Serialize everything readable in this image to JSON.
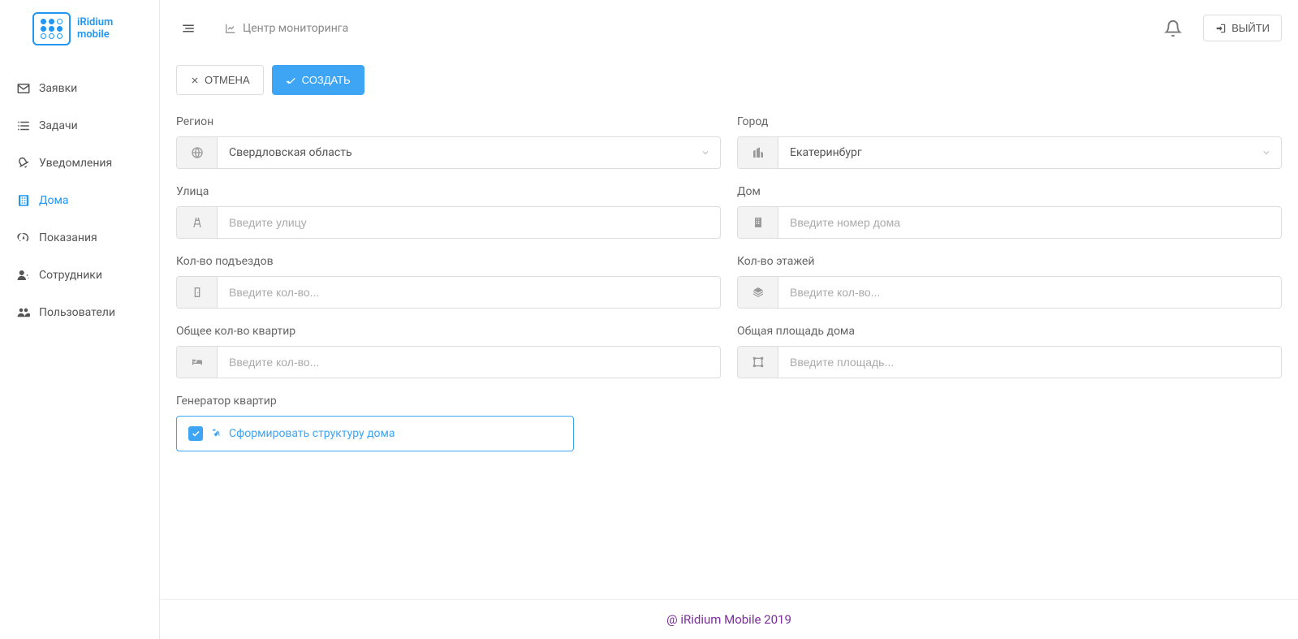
{
  "logo": {
    "line1": "iRidium",
    "line2": "mobile"
  },
  "sidebar": {
    "items": [
      {
        "label": "Заявки",
        "icon": "envelope"
      },
      {
        "label": "Задачи",
        "icon": "list-check"
      },
      {
        "label": "Уведомления",
        "icon": "bullhorn"
      },
      {
        "label": "Дома",
        "icon": "building",
        "active": true
      },
      {
        "label": "Показания",
        "icon": "gauge"
      },
      {
        "label": "Сотрудники",
        "icon": "user-gear"
      },
      {
        "label": "Пользователи",
        "icon": "users"
      }
    ]
  },
  "topbar": {
    "breadcrumb": "Центр мониторинга",
    "logout": "ВЫЙТИ"
  },
  "actions": {
    "cancel": "ОТМЕНА",
    "create": "СОЗДАТЬ"
  },
  "form": {
    "region": {
      "label": "Регион",
      "value": "Свердловская область"
    },
    "city": {
      "label": "Город",
      "value": "Екатеринбург"
    },
    "street": {
      "label": "Улица",
      "placeholder": "Введите улицу"
    },
    "house": {
      "label": "Дом",
      "placeholder": "Введите номер дома"
    },
    "entrances": {
      "label": "Кол-во подъездов",
      "placeholder": "Введите кол-во..."
    },
    "floors": {
      "label": "Кол-во этажей",
      "placeholder": "Введите кол-во..."
    },
    "apartments": {
      "label": "Общее кол-во квартир",
      "placeholder": "Введите кол-во..."
    },
    "area": {
      "label": "Общая площадь дома",
      "placeholder": "Введите площадь..."
    }
  },
  "generator": {
    "label": "Генератор квартир",
    "text": "Сформировать структуру дома"
  },
  "footer": "@ iRidium Mobile 2019"
}
